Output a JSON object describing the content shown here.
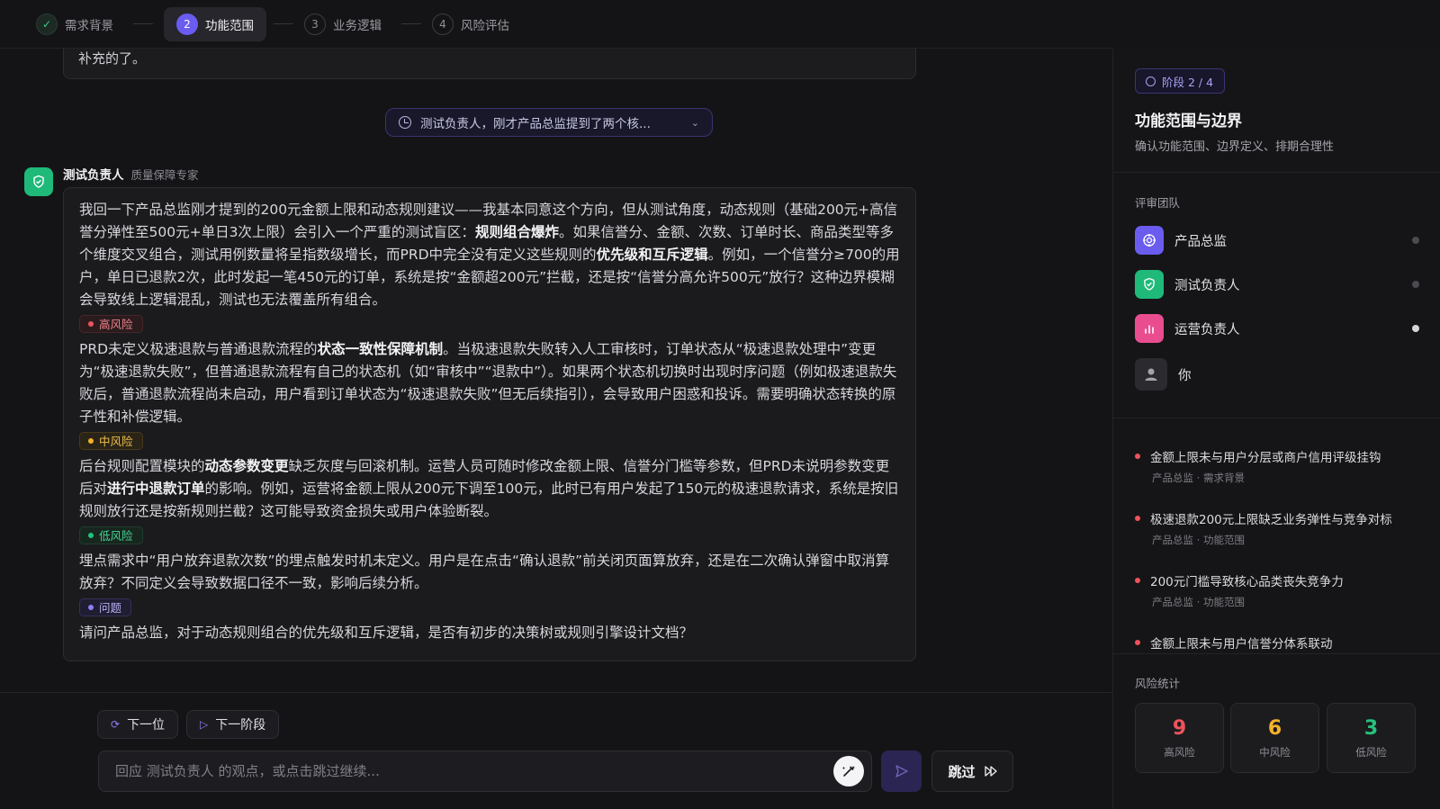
{
  "stepper": {
    "steps": [
      {
        "num": "✓",
        "label": "需求背景"
      },
      {
        "num": "2",
        "label": "功能范围"
      },
      {
        "num": "3",
        "label": "业务逻辑"
      },
      {
        "num": "4",
        "label": "风险评估"
      }
    ]
  },
  "chat": {
    "prev_text": "补充的了。",
    "quote_text": "测试负责人，刚才产品总监提到了两个核...",
    "speaker_name": "测试负责人",
    "speaker_role": "质量保障专家",
    "message": {
      "p1": [
        "我回一下产品总监刚才提到的200元金额上限和动态规则建议——我基本同意这个方向，但从测试角度，动态规则（基础200元+高信誉分弹性至500元+单日3次上限）会引入一个严重的测试盲区：",
        "规则组合爆炸",
        "。如果信誉分、金额、次数、订单时长、商品类型等多个维度交叉组合，测试用例数量将呈指数级增长，而PRD中完全没有定义这些规则的",
        "优先级和互斥逻辑",
        "。例如，一个信誉分≥700的用户，单日已退款2次，此时发起一笔450元的订单，系统是按“金额超200元”拦截，还是按“信誉分高允许500元”放行？这种边界模糊会导致线上逻辑混乱，测试也无法覆盖所有组合。"
      ],
      "tag1": "高风险",
      "p2": [
        "PRD未定义极速退款与普通退款流程的",
        "状态一致性保障机制",
        "。当极速退款失败转入人工审核时，订单状态从“极速退款处理中”变更为“极速退款失败”，但普通退款流程有自己的状态机（如“审核中”“退款中”）。如果两个状态机切换时出现时序问题（例如极速退款失败后，普通退款流程尚未启动，用户看到订单状态为“极速退款失败”但无后续指引），会导致用户困惑和投诉。需要明确状态转换的原子性和补偿逻辑。"
      ],
      "tag2": "中风险",
      "p3": [
        "后台规则配置模块的",
        "动态参数变更",
        "缺乏灰度与回滚机制。运营人员可随时修改金额上限、信誉分门槛等参数，但PRD未说明参数变更后对",
        "进行中退款订单",
        "的影响。例如，运营将金额上限从200元下调至100元，此时已有用户发起了150元的极速退款请求，系统是按旧规则放行还是按新规则拦截？这可能导致资金损失或用户体验断裂。"
      ],
      "tag3": "低风险",
      "p4": "埋点需求中“用户放弃退款次数”的埋点触发时机未定义。用户是在点击“确认退款”前关闭页面算放弃，还是在二次确认弹窗中取消算放弃？不同定义会导致数据口径不一致，影响后续分析。",
      "tag4": "问题",
      "p5": "请问产品总监，对于动态规则组合的优先级和互斥逻辑，是否有初步的决策树或规则引擎设计文档？"
    }
  },
  "composer": {
    "next_person": "下一位",
    "next_stage": "下一阶段",
    "placeholder": "回应 测试负责人 的观点，或点击跳过继续...",
    "skip": "跳过"
  },
  "panel": {
    "stage_badge": "阶段 2 / 4",
    "title": "功能范围与边界",
    "subtitle": "确认功能范围、边界定义、排期合理性",
    "team_label": "评审团队",
    "members": [
      {
        "name": "产品总监",
        "color": "#6b5cf0",
        "icon": "target-icon"
      },
      {
        "name": "测试负责人",
        "color": "#1fb97a",
        "icon": "shield-check-icon"
      },
      {
        "name": "运营负责人",
        "color": "#e94d8f",
        "icon": "bar-chart-icon"
      },
      {
        "name": "你",
        "color": "#2a2a2f",
        "icon": "user-icon"
      }
    ],
    "issues": [
      {
        "title": "金额上限未与用户分层或商户信用评级挂钩",
        "meta": "产品总监 · 需求背景"
      },
      {
        "title": "极速退款200元上限缺乏业务弹性与竞争对标",
        "meta": "产品总监 · 功能范围"
      },
      {
        "title": "200元门槛导致核心品类丧失竞争力",
        "meta": "产品总监 · 功能范围"
      },
      {
        "title": "金额上限未与用户信誉分体系联动",
        "meta": ""
      }
    ],
    "risk_label": "风险统计",
    "risk": [
      {
        "count": "9",
        "label": "高风险",
        "color": "#f0525c"
      },
      {
        "count": "6",
        "label": "中风险",
        "color": "#f3b22a"
      },
      {
        "count": "3",
        "label": "低风险",
        "color": "#25c27b"
      }
    ]
  }
}
